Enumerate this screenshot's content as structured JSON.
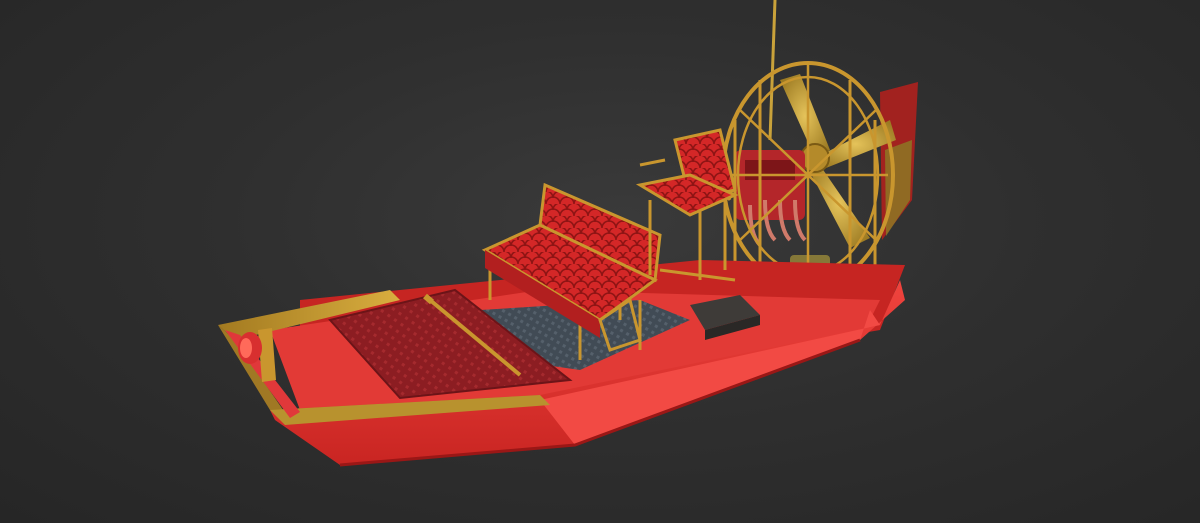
{
  "viewer": {
    "background_color": "#2f2f2f",
    "subject": "airboat-3d-model"
  },
  "colors": {
    "hull_red": "#e8322f",
    "hull_dark_red": "#b81f1d",
    "deck_plate": "#8f1d22",
    "gold_trim": "#b8922e",
    "seat_red": "#d92a2a",
    "propeller_gold": "#c9a23a",
    "floor_blue_grey": "#4a5560"
  },
  "icons": [
    "seat-icon",
    "propeller-icon",
    "cage-icon",
    "engine-icon",
    "spotlight-icon",
    "antenna-icon"
  ]
}
